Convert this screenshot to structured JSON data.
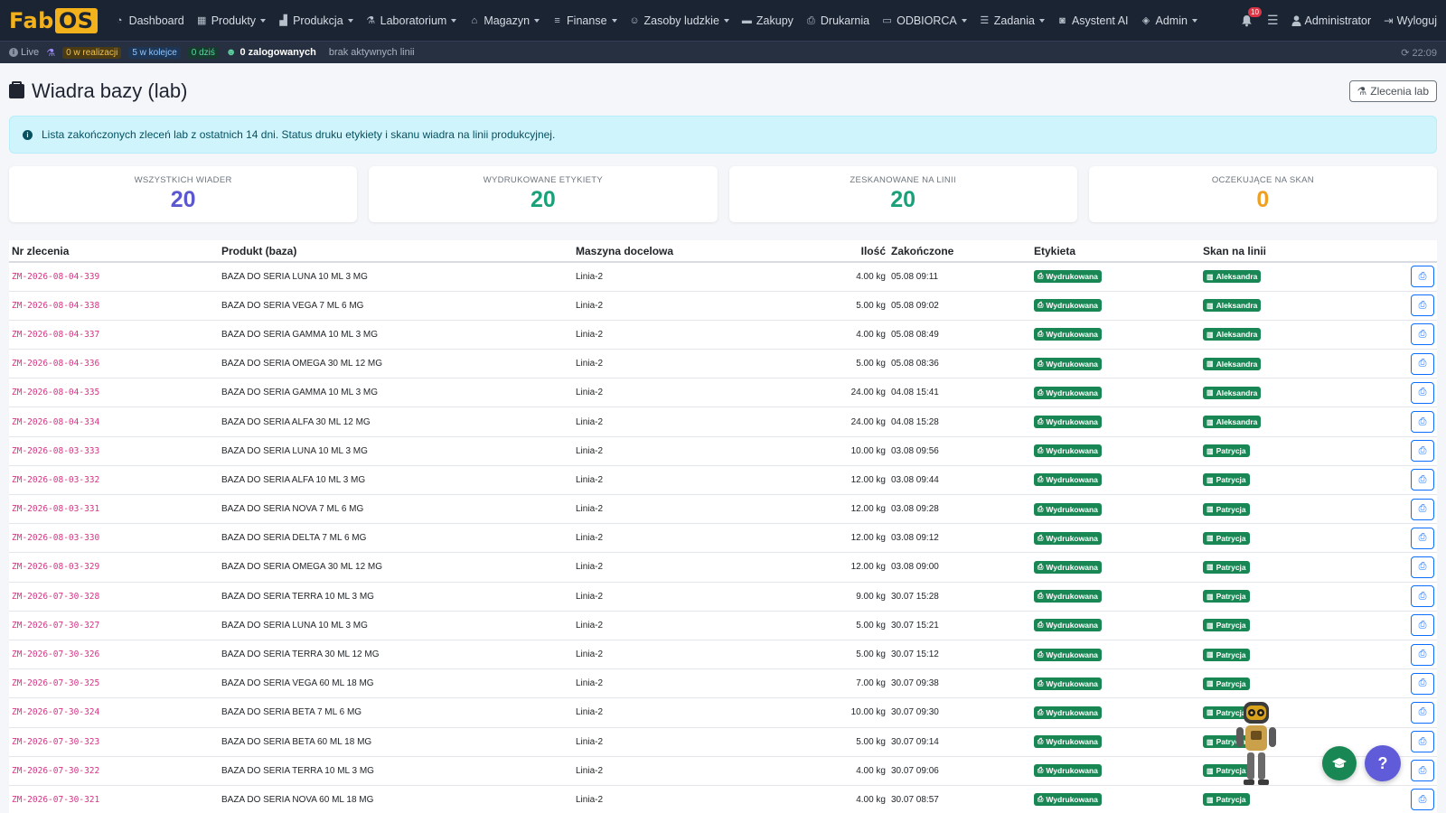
{
  "brand": {
    "part1": "Fab",
    "part2": "OS"
  },
  "nav": [
    {
      "label": "Dashboard",
      "icon": "dashboard-icon",
      "glyph": "◔",
      "dropdown": false
    },
    {
      "label": "Produkty",
      "icon": "products-icon",
      "glyph": "▦",
      "dropdown": true
    },
    {
      "label": "Produkcja",
      "icon": "factory-icon",
      "glyph": "▟",
      "dropdown": true
    },
    {
      "label": "Laboratorium",
      "icon": "lab-icon",
      "glyph": "⚗",
      "dropdown": true
    },
    {
      "label": "Magazyn",
      "icon": "warehouse-icon",
      "glyph": "⌂",
      "dropdown": true
    },
    {
      "label": "Finanse",
      "icon": "coins-icon",
      "glyph": "≡",
      "dropdown": true
    },
    {
      "label": "Zasoby ludzkie",
      "icon": "people-icon",
      "glyph": "☺",
      "dropdown": true
    },
    {
      "label": "Zakupy",
      "icon": "truck-icon",
      "glyph": "▬",
      "dropdown": false
    },
    {
      "label": "Drukarnia",
      "icon": "printer-icon",
      "glyph": "⎙",
      "dropdown": false
    },
    {
      "label": "ODBIORCA",
      "icon": "box-icon",
      "glyph": "▭",
      "dropdown": true
    },
    {
      "label": "Zadania",
      "icon": "tasks-icon",
      "glyph": "☰",
      "dropdown": true
    },
    {
      "label": "Asystent AI",
      "icon": "robot-icon",
      "glyph": "◙",
      "dropdown": false
    },
    {
      "label": "Admin",
      "icon": "shield-icon",
      "glyph": "◈",
      "dropdown": true
    }
  ],
  "nav_right": {
    "notifications": "10",
    "user": "Administrator",
    "logout": "Wyloguj"
  },
  "statusbar": {
    "live": "Live",
    "in_progress": "0 w realizacji",
    "queue": "5 w kolejce",
    "today": "0 dziś",
    "logged": "0 zalogowanych",
    "lines": "brak aktywnych linii",
    "time": "22:09"
  },
  "page": {
    "title": "Wiadra bazy (lab)",
    "lab_orders_button": "Zlecenia lab"
  },
  "alert": "Lista zakończonych zleceń lab z ostatnich 14 dni. Status druku etykiety i skanu wiadra na linii produkcyjnej.",
  "stats": [
    {
      "label": "WSZYSTKICH WIADER",
      "value": "20",
      "color": "#5b57d1"
    },
    {
      "label": "WYDRUKOWANE ETYKIETY",
      "value": "20",
      "color": "#1aa179"
    },
    {
      "label": "ZESKANOWANE NA LINII",
      "value": "20",
      "color": "#1aa179"
    },
    {
      "label": "OCZEKUJĄCE NA SKAN",
      "value": "0",
      "color": "#f0a020"
    }
  ],
  "table": {
    "headers": [
      "Nr zlecenia",
      "Produkt (baza)",
      "Maszyna docelowa",
      "Ilość",
      "Zakończone",
      "Etykieta",
      "Skan na linii",
      ""
    ],
    "rows": [
      {
        "order": "ZM-2026-08-04-339",
        "product": "BAZA DO SERIA LUNA 10 ML 3 MG",
        "machine": "Linia-2",
        "qty": "4.00 kg",
        "done": "05.08 09:11",
        "label": "Wydrukowana",
        "scan": "Aleksandra"
      },
      {
        "order": "ZM-2026-08-04-338",
        "product": "BAZA DO SERIA VEGA 7 ML 6 MG",
        "machine": "Linia-2",
        "qty": "5.00 kg",
        "done": "05.08 09:02",
        "label": "Wydrukowana",
        "scan": "Aleksandra"
      },
      {
        "order": "ZM-2026-08-04-337",
        "product": "BAZA DO SERIA GAMMA 10 ML 3 MG",
        "machine": "Linia-2",
        "qty": "4.00 kg",
        "done": "05.08 08:49",
        "label": "Wydrukowana",
        "scan": "Aleksandra"
      },
      {
        "order": "ZM-2026-08-04-336",
        "product": "BAZA DO SERIA OMEGA 30 ML 12 MG",
        "machine": "Linia-2",
        "qty": "5.00 kg",
        "done": "05.08 08:36",
        "label": "Wydrukowana",
        "scan": "Aleksandra"
      },
      {
        "order": "ZM-2026-08-04-335",
        "product": "BAZA DO SERIA GAMMA 10 ML 3 MG",
        "machine": "Linia-2",
        "qty": "24.00 kg",
        "done": "04.08 15:41",
        "label": "Wydrukowana",
        "scan": "Aleksandra"
      },
      {
        "order": "ZM-2026-08-04-334",
        "product": "BAZA DO SERIA ALFA 30 ML 12 MG",
        "machine": "Linia-2",
        "qty": "24.00 kg",
        "done": "04.08 15:28",
        "label": "Wydrukowana",
        "scan": "Aleksandra"
      },
      {
        "order": "ZM-2026-08-03-333",
        "product": "BAZA DO SERIA LUNA 10 ML 3 MG",
        "machine": "Linia-2",
        "qty": "10.00 kg",
        "done": "03.08 09:56",
        "label": "Wydrukowana",
        "scan": "Patrycja"
      },
      {
        "order": "ZM-2026-08-03-332",
        "product": "BAZA DO SERIA ALFA 10 ML 3 MG",
        "machine": "Linia-2",
        "qty": "12.00 kg",
        "done": "03.08 09:44",
        "label": "Wydrukowana",
        "scan": "Patrycja"
      },
      {
        "order": "ZM-2026-08-03-331",
        "product": "BAZA DO SERIA NOVA 7 ML 6 MG",
        "machine": "Linia-2",
        "qty": "12.00 kg",
        "done": "03.08 09:28",
        "label": "Wydrukowana",
        "scan": "Patrycja"
      },
      {
        "order": "ZM-2026-08-03-330",
        "product": "BAZA DO SERIA DELTA 7 ML 6 MG",
        "machine": "Linia-2",
        "qty": "12.00 kg",
        "done": "03.08 09:12",
        "label": "Wydrukowana",
        "scan": "Patrycja"
      },
      {
        "order": "ZM-2026-08-03-329",
        "product": "BAZA DO SERIA OMEGA 30 ML 12 MG",
        "machine": "Linia-2",
        "qty": "12.00 kg",
        "done": "03.08 09:00",
        "label": "Wydrukowana",
        "scan": "Patrycja"
      },
      {
        "order": "ZM-2026-07-30-328",
        "product": "BAZA DO SERIA TERRA 10 ML 3 MG",
        "machine": "Linia-2",
        "qty": "9.00 kg",
        "done": "30.07 15:28",
        "label": "Wydrukowana",
        "scan": "Patrycja"
      },
      {
        "order": "ZM-2026-07-30-327",
        "product": "BAZA DO SERIA LUNA 10 ML 3 MG",
        "machine": "Linia-2",
        "qty": "5.00 kg",
        "done": "30.07 15:21",
        "label": "Wydrukowana",
        "scan": "Patrycja"
      },
      {
        "order": "ZM-2026-07-30-326",
        "product": "BAZA DO SERIA TERRA 30 ML 12 MG",
        "machine": "Linia-2",
        "qty": "5.00 kg",
        "done": "30.07 15:12",
        "label": "Wydrukowana",
        "scan": "Patrycja"
      },
      {
        "order": "ZM-2026-07-30-325",
        "product": "BAZA DO SERIA VEGA 60 ML 18 MG",
        "machine": "Linia-2",
        "qty": "7.00 kg",
        "done": "30.07 09:38",
        "label": "Wydrukowana",
        "scan": "Patrycja"
      },
      {
        "order": "ZM-2026-07-30-324",
        "product": "BAZA DO SERIA BETA 7 ML 6 MG",
        "machine": "Linia-2",
        "qty": "10.00 kg",
        "done": "30.07 09:30",
        "label": "Wydrukowana",
        "scan": "Patrycja"
      },
      {
        "order": "ZM-2026-07-30-323",
        "product": "BAZA DO SERIA BETA 60 ML 18 MG",
        "machine": "Linia-2",
        "qty": "5.00 kg",
        "done": "30.07 09:14",
        "label": "Wydrukowana",
        "scan": "Patrycja"
      },
      {
        "order": "ZM-2026-07-30-322",
        "product": "BAZA DO SERIA TERRA 10 ML 3 MG",
        "machine": "Linia-2",
        "qty": "4.00 kg",
        "done": "30.07 09:06",
        "label": "Wydrukowana",
        "scan": "Patrycja"
      },
      {
        "order": "ZM-2026-07-30-321",
        "product": "BAZA DO SERIA NOVA 60 ML 18 MG",
        "machine": "Linia-2",
        "qty": "4.00 kg",
        "done": "30.07 08:57",
        "label": "Wydrukowana",
        "scan": "Patrycja"
      }
    ]
  },
  "floating": {
    "help_glyph": "?",
    "academy_icon": "graduation-cap-icon"
  }
}
